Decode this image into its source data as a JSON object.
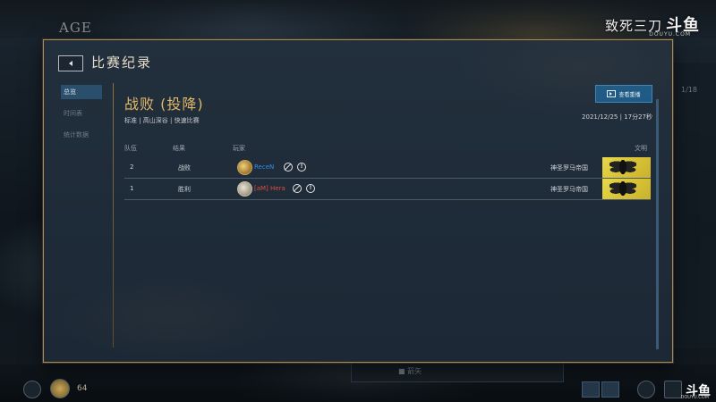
{
  "background": {
    "logo": "AGE",
    "watermark_text": "致死三刀",
    "watermark_brand": "斗鱼",
    "watermark_sub": "DOUYU.COM",
    "right_panel_text": "1/18",
    "bottom_number": "64",
    "bottom_center_text": "■ 箭矢"
  },
  "dialog": {
    "title": "比赛纪录",
    "nav": [
      {
        "label": "总览",
        "active": true
      },
      {
        "label": "时间表",
        "active": false
      },
      {
        "label": "统计数据",
        "active": false
      }
    ],
    "result_title": "战败 (投降)",
    "meta": "标准 | 高山深谷 | 快速比赛",
    "replay_button": "查看重播",
    "date": "2021/12/25 | 17分27秒",
    "columns": {
      "team": "队伍",
      "result": "结果",
      "player": "玩家",
      "civ": "文明"
    },
    "rows": [
      {
        "team": "2",
        "result": "战败",
        "player": "ReceN",
        "player_color": "#2f8ff0",
        "emblem": "gold",
        "civ": "神圣罗马帝国"
      },
      {
        "team": "1",
        "result": "胜利",
        "player": "[aM] Hera",
        "player_color": "#e64a3a",
        "emblem": "silver",
        "civ": "神圣罗马帝国"
      }
    ]
  },
  "colors": {
    "accent_gold": "#e0b86a",
    "border_gold": "#a98c55",
    "nav_active": "#2a4f6c",
    "replay_blue": "#1e5a86"
  }
}
